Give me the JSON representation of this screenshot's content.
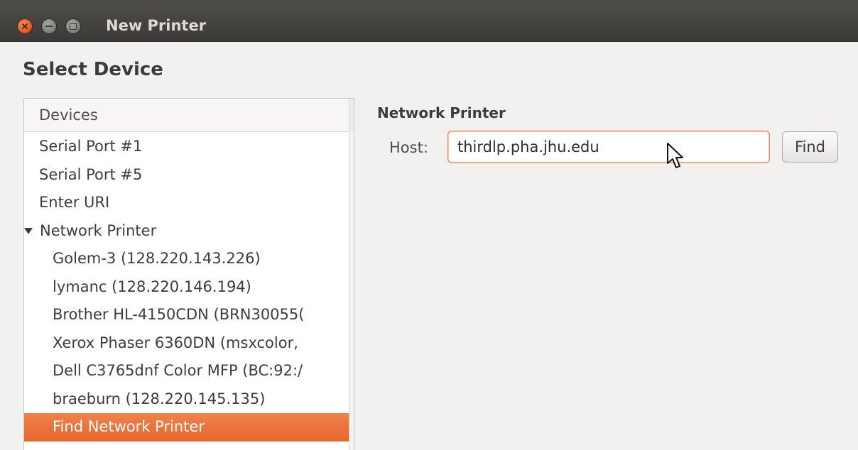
{
  "window": {
    "title": "New Printer",
    "controls": [
      "close",
      "minimize",
      "maximize"
    ]
  },
  "page": {
    "heading": "Select Device"
  },
  "device_list": {
    "header": "Devices",
    "items": [
      {
        "label": "Serial Port #1",
        "level": 1
      },
      {
        "label": "Serial Port #5",
        "level": 1
      },
      {
        "label": "Enter URI",
        "level": 1
      },
      {
        "label": "Network Printer",
        "level": 1,
        "expanded": true
      },
      {
        "label": "Golem-3 (128.220.143.226)",
        "level": 2
      },
      {
        "label": "lymanc (128.220.146.194)",
        "level": 2
      },
      {
        "label": "Brother HL-4150CDN (BRN30055(",
        "level": 2
      },
      {
        "label": "Xerox Phaser 6360DN (msxcolor,",
        "level": 2
      },
      {
        "label": "Dell C3765dnf Color MFP (BC:92:/",
        "level": 2
      },
      {
        "label": "braeburn (128.220.145.135)",
        "level": 2
      },
      {
        "label": "Find Network Printer",
        "level": 2,
        "selected": true
      }
    ]
  },
  "network_printer": {
    "section_title": "Network Printer",
    "host_label": "Host:",
    "host_value": "thirdlp.pha.jhu.edu",
    "find_label": "Find"
  },
  "colors": {
    "accent": "#e5662c",
    "titlebar": "#3c3b37",
    "background": "#f2f1f0"
  }
}
